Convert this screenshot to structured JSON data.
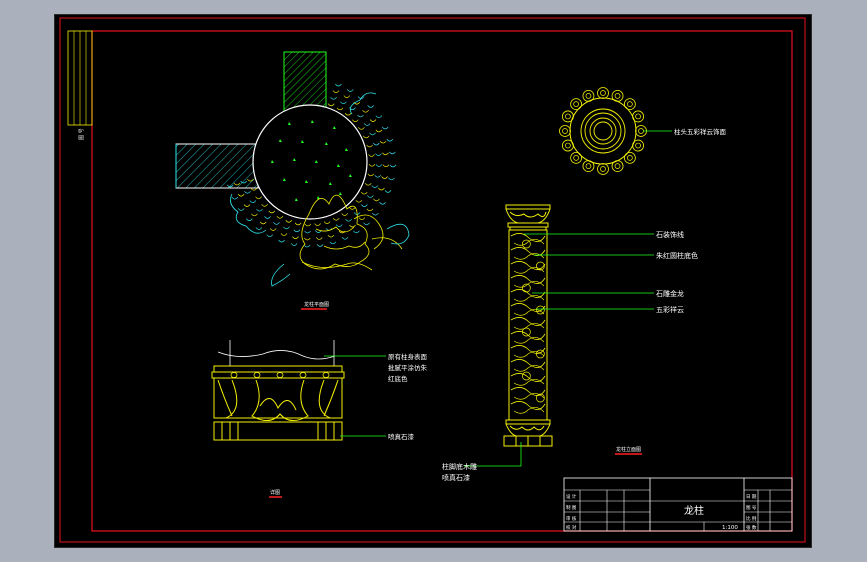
{
  "drawing": {
    "title": "龙柱",
    "scale": "1:100",
    "colors": {
      "background": "#000000",
      "border": "#e8121e",
      "yellow": "#f4f000",
      "green": "#20ff20",
      "cyan": "#2ee6ee",
      "white": "#ffffff",
      "red_underline": "#ff2020",
      "window_bg": "#aab1bd"
    },
    "plan_label": "龙柱平面图",
    "detail_label": "详图",
    "elevation_label": "龙柱立面图",
    "top_annotation": "柱头五彩祥云饰面",
    "elevation_annotations": [
      "石装饰线",
      "朱红圆柱底色",
      "石雕金龙",
      "五彩祥云"
    ],
    "base_annotation_line1": "柱脚底木雕",
    "base_annotation_line2": "喷真石漆",
    "detail_annotation_lines": [
      "原有柱身表面",
      "批腻平涂仿朱",
      "红底色"
    ],
    "detail_base_annotation": "喷真石漆",
    "side_strip_text": "图 号",
    "title_block_left": [
      "设 计",
      "制 图",
      "审 核",
      "校 对"
    ],
    "title_block_right": [
      "日 期",
      "图 号",
      "比 例",
      "张 数"
    ]
  }
}
